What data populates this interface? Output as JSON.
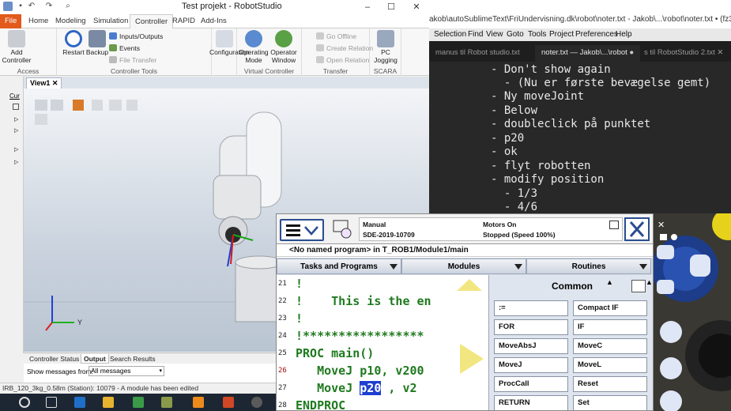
{
  "robotstudio": {
    "title": "Test projekt - RobotStudio",
    "tabs": [
      "File",
      "Home",
      "Modeling",
      "Simulation",
      "Controller",
      "RAPID",
      "Add-Ins"
    ],
    "active_tab": "Controller",
    "ribbon": {
      "access": {
        "label": "Access",
        "add_controller": "Add Controller"
      },
      "controller_tools": {
        "label": "Controller Tools",
        "restart": "Restart",
        "backup": "Backup",
        "inputs_outputs": "Inputs/Outputs",
        "events": "Events",
        "file_transfer": "File Transfer"
      },
      "configuration": {
        "label": "Configuration"
      },
      "virtual_controller": {
        "label": "Virtual Controller",
        "operating_mode": "Operating Mode",
        "operator_window": "Operator Window"
      },
      "transfer": {
        "label": "Transfer",
        "go_offline": "Go Offline",
        "create_relation": "Create Relation",
        "open_relation": "Open Relation"
      },
      "scara": {
        "label": "SCARA",
        "pc_jogging": "PC Jogging"
      }
    },
    "view_tab": "View1",
    "left_panel_tab": "Cur",
    "output_tabs": [
      "Controller Status",
      "Output",
      "Search Results"
    ],
    "active_output_tab": "Output",
    "show_messages_label": "Show messages from:",
    "show_messages_value": "All messages",
    "status": "IRB_120_3kg_0.58m (Station): 10079 - A module has been edited",
    "axis_y": "Y"
  },
  "sublime": {
    "title": "akob\\autoSublimeText\\FriUndervisning.dk\\robot\\noter.txt - Jakob\\...\\robot\\noter.txt • (fz3-156464257386...",
    "menu": [
      "Selection",
      "Find",
      "View",
      "Goto",
      "Tools",
      "Project",
      "Preferences",
      "Help"
    ],
    "tabs": [
      "manus til Robot studio.txt",
      "noter.txt — Jakob\\...\\robot",
      "s til RobotStudio 2.txt"
    ],
    "active_tab_index": 1,
    "lines": [
      "- Don't show again",
      "  - (Nu er første bevægelse gemt)",
      "- Ny moveJoint",
      "- Below",
      "- doubleclick på punktet",
      "- p20",
      "- ok",
      "- flyt robotten",
      "- modify position",
      "  - 1/3",
      "  - 4/6"
    ]
  },
  "flexpendant": {
    "mode": "Manual",
    "system": "SDE-2019-10709",
    "motors": "Motors On",
    "state": "Stopped (Speed 100%)",
    "path": "<No named program> in T_ROB1/Module1/main",
    "nav_tabs": [
      "Tasks and Programs",
      "Modules",
      "Routines"
    ],
    "code": [
      {
        "n": "21",
        "text": "!"
      },
      {
        "n": "22",
        "text": "!    This is the en"
      },
      {
        "n": "23",
        "text": "!"
      },
      {
        "n": "24",
        "text": "!*****************"
      },
      {
        "n": "25",
        "text": "PROC main()"
      },
      {
        "n": "26",
        "text": "   MoveJ p10, v200"
      },
      {
        "n": "27",
        "pre": "   MoveJ ",
        "hl": "p20",
        "post": " , v2"
      },
      {
        "n": "28",
        "text": "ENDPROC"
      }
    ],
    "common_title": "Common",
    "common_buttons": [
      [
        ":=",
        "Compact IF"
      ],
      [
        "FOR",
        "IF"
      ],
      [
        "MoveAbsJ",
        "MoveC"
      ],
      [
        "MoveJ",
        "MoveL"
      ],
      [
        "ProcCall",
        "Reset"
      ],
      [
        "RETURN",
        "Set"
      ]
    ]
  },
  "colors": {
    "file_tab": "#e25a1c",
    "code_green": "#1f7a1f",
    "highlight": "#1d3fd0",
    "pendant_blue": "#2a4d8f"
  }
}
